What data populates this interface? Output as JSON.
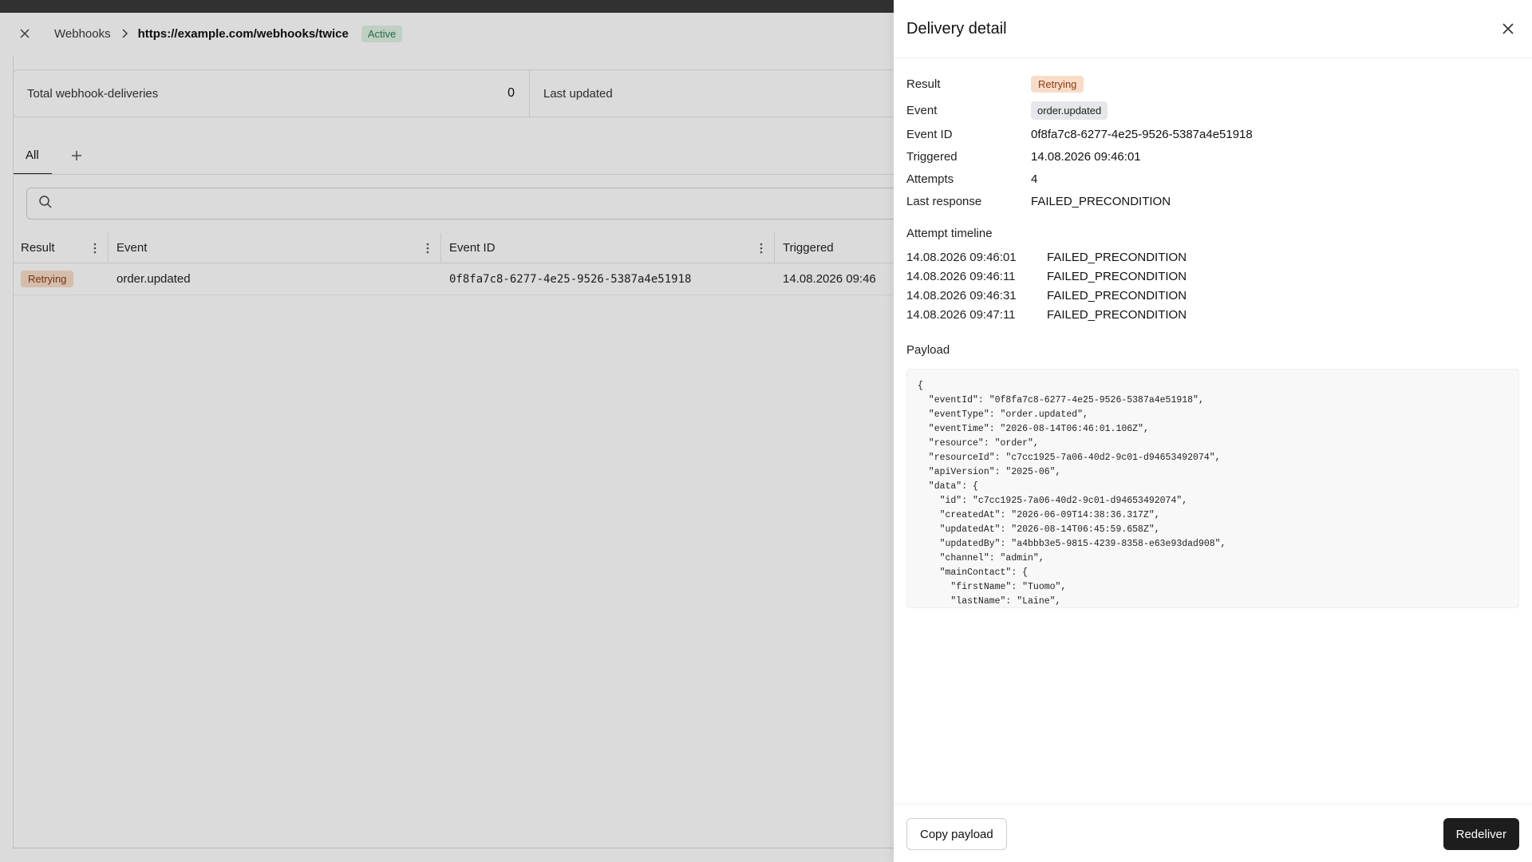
{
  "background": {
    "breadcrumb": {
      "root": "Webhooks",
      "current": "https://example.com/webhooks/twice",
      "status": "Active"
    },
    "stats": {
      "total_label": "Total webhook-deliveries",
      "total_value": "0",
      "updated_label": "Last updated"
    },
    "tabs": [
      {
        "label": "All"
      }
    ],
    "search": {
      "placeholder": ""
    },
    "table": {
      "columns": [
        "Result",
        "Event",
        "Event ID",
        "Triggered"
      ],
      "rows": [
        {
          "result": "Retrying",
          "event": "order.updated",
          "event_id": "0f8fa7c8-6277-4e25-9526-5387a4e51918",
          "triggered": "14.08.2026 09:46"
        }
      ]
    }
  },
  "drawer": {
    "title": "Delivery detail",
    "fields": {
      "result_label": "Result",
      "result_value": "Retrying",
      "event_label": "Event",
      "event_value": "order.updated",
      "event_id_label": "Event ID",
      "event_id_value": "0f8fa7c8-6277-4e25-9526-5387a4e51918",
      "triggered_label": "Triggered",
      "triggered_value": "14.08.2026 09:46:01",
      "attempts_label": "Attempts",
      "attempts_value": "4",
      "last_response_label": "Last response",
      "last_response_value": "FAILED_PRECONDITION"
    },
    "timeline_title": "Attempt timeline",
    "timeline": [
      {
        "time": "14.08.2026 09:46:01",
        "status": "FAILED_PRECONDITION"
      },
      {
        "time": "14.08.2026 09:46:11",
        "status": "FAILED_PRECONDITION"
      },
      {
        "time": "14.08.2026 09:46:31",
        "status": "FAILED_PRECONDITION"
      },
      {
        "time": "14.08.2026 09:47:11",
        "status": "FAILED_PRECONDITION"
      }
    ],
    "payload_title": "Payload",
    "payload": "{\n  \"eventId\": \"0f8fa7c8-6277-4e25-9526-5387a4e51918\",\n  \"eventType\": \"order.updated\",\n  \"eventTime\": \"2026-08-14T06:46:01.106Z\",\n  \"resource\": \"order\",\n  \"resourceId\": \"c7cc1925-7a06-40d2-9c01-d94653492074\",\n  \"apiVersion\": \"2025-06\",\n  \"data\": {\n    \"id\": \"c7cc1925-7a06-40d2-9c01-d94653492074\",\n    \"createdAt\": \"2026-06-09T14:38:36.317Z\",\n    \"updatedAt\": \"2026-08-14T06:45:59.658Z\",\n    \"updatedBy\": \"a4bbb3e5-9815-4239-8358-e63e93dad908\",\n    \"channel\": \"admin\",\n    \"mainContact\": {\n      \"firstName\": \"Tuomo\",\n      \"lastName\": \"Laine\",",
    "copy_label": "Copy payload",
    "redeliver_label": "Redeliver"
  }
}
